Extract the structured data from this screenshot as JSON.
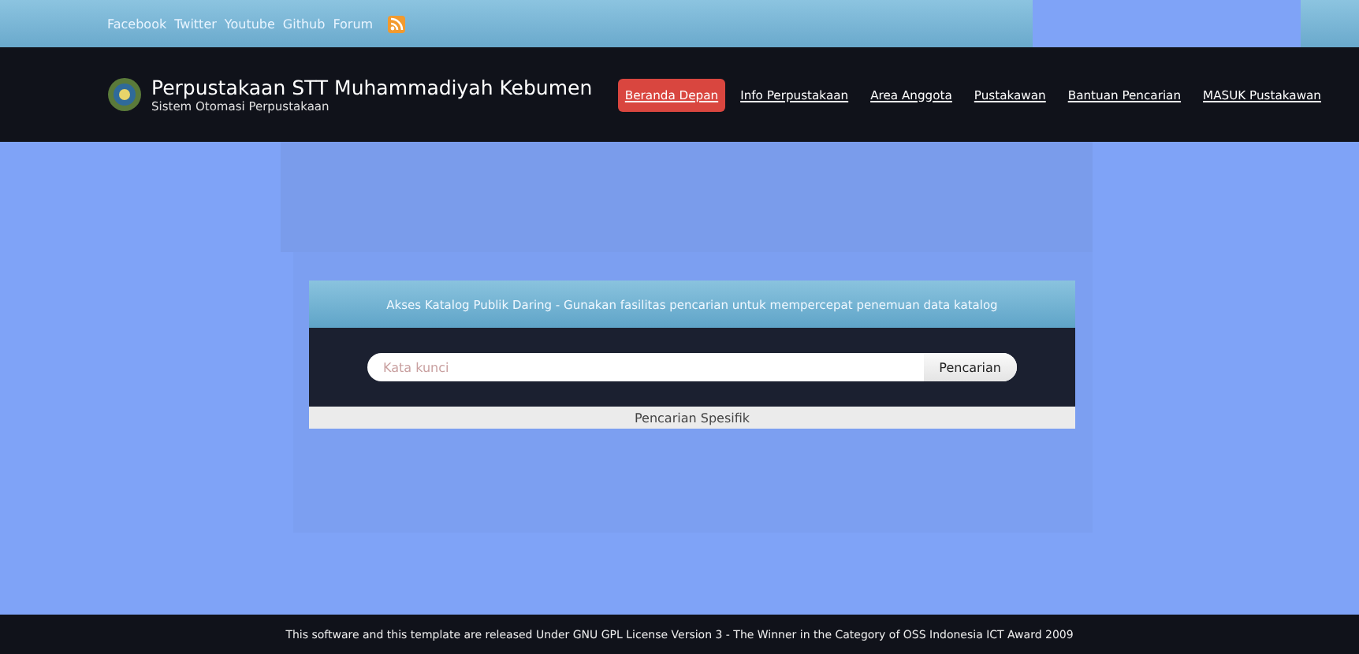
{
  "top_links": [
    "Facebook",
    "Twitter",
    "Youtube",
    "Github",
    "Forum"
  ],
  "header": {
    "title": "Perpustakaan STT Muhammadiyah Kebumen",
    "subtitle": "Sistem Otomasi Perpustakaan"
  },
  "nav": [
    {
      "label": "Beranda Depan",
      "selected": true
    },
    {
      "label": "Info Perpustakaan",
      "selected": false
    },
    {
      "label": "Area Anggota",
      "selected": false
    },
    {
      "label": "Pustakawan",
      "selected": false
    },
    {
      "label": "Bantuan Pencarian",
      "selected": false
    },
    {
      "label": "MASUK Pustakawan",
      "selected": false
    }
  ],
  "search_card": {
    "heading": "Akses Katalog Publik Daring - Gunakan fasilitas pencarian untuk mempercepat penemuan data katalog",
    "placeholder": "Kata kunci",
    "button": "Pencarian",
    "advanced": "Pencarian Spesifik"
  },
  "footer": "This software and this template are released Under GNU GPL License Version 3 - The Winner in the Category of OSS Indonesia ICT Award 2009"
}
